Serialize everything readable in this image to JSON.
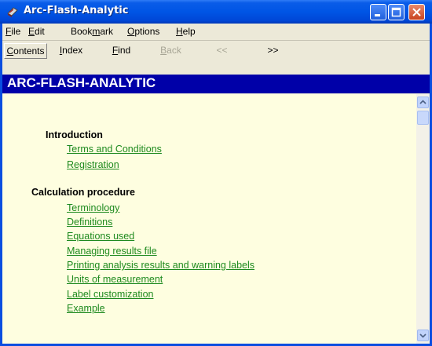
{
  "window": {
    "title": "Arc-Flash-Analytic"
  },
  "menu": [
    {
      "label": "File",
      "accel": "F",
      "rest": "ile"
    },
    {
      "label": "Edit",
      "accel": "E",
      "rest": "dit"
    },
    {
      "label": "Bookmark",
      "pre": "Book",
      "accel": "m",
      "rest": "ark"
    },
    {
      "label": "Options",
      "accel": "O",
      "rest": "ptions"
    },
    {
      "label": "Help",
      "accel": "H",
      "rest": "elp"
    }
  ],
  "toolbar": {
    "contents": {
      "accel": "C",
      "rest": "ontents"
    },
    "index": {
      "accel": "I",
      "rest": "ndex"
    },
    "find": {
      "accel": "F",
      "rest": "ind"
    },
    "back": {
      "accel": "B",
      "rest": "ack"
    },
    "prev": {
      "label": "<<"
    },
    "next": {
      "label": ">>"
    }
  },
  "banner": {
    "title": "ARC-FLASH-ANALYTIC"
  },
  "sections": [
    {
      "heading": "Introduction",
      "links": [
        "Terms and Conditions",
        "Registration"
      ]
    },
    {
      "heading": "Calculation procedure",
      "links": [
        "Terminology",
        "Definitions",
        "Equations used",
        "Managing results file",
        "Printing  analysis results and warning labels",
        "Units of measurement",
        "Label customization",
        "Example"
      ]
    }
  ],
  "colors": {
    "banner": "#0000a8",
    "link": "#1e8a1e",
    "content_bg": "#fefee0",
    "titlebar": "#0055e5"
  }
}
